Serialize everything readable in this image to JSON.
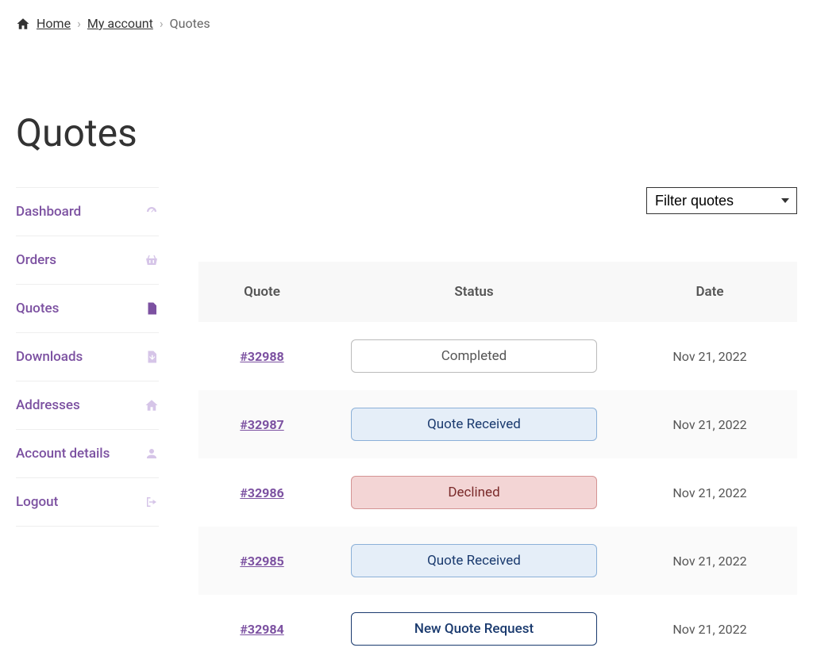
{
  "breadcrumb": {
    "home": "Home",
    "account": "My account",
    "current": "Quotes"
  },
  "page_title": "Quotes",
  "sidebar": {
    "items": [
      {
        "label": "Dashboard",
        "icon": "dashboard",
        "active": false
      },
      {
        "label": "Orders",
        "icon": "basket",
        "active": false
      },
      {
        "label": "Quotes",
        "icon": "file",
        "active": true
      },
      {
        "label": "Downloads",
        "icon": "download",
        "active": false
      },
      {
        "label": "Addresses",
        "icon": "home",
        "active": false
      },
      {
        "label": "Account details",
        "icon": "user",
        "active": false
      },
      {
        "label": "Logout",
        "icon": "logout",
        "active": false
      }
    ]
  },
  "filter": {
    "label": "Filter quotes"
  },
  "table": {
    "headers": {
      "quote": "Quote",
      "status": "Status",
      "date": "Date"
    },
    "rows": [
      {
        "id": "#32988",
        "status": "Completed",
        "status_class": "completed",
        "date": "Nov 21, 2022"
      },
      {
        "id": "#32987",
        "status": "Quote Received",
        "status_class": "received",
        "date": "Nov 21, 2022"
      },
      {
        "id": "#32986",
        "status": "Declined",
        "status_class": "declined",
        "date": "Nov 21, 2022"
      },
      {
        "id": "#32985",
        "status": "Quote Received",
        "status_class": "received",
        "date": "Nov 21, 2022"
      },
      {
        "id": "#32984",
        "status": "New Quote Request",
        "status_class": "new",
        "date": "Nov 21, 2022"
      }
    ]
  }
}
